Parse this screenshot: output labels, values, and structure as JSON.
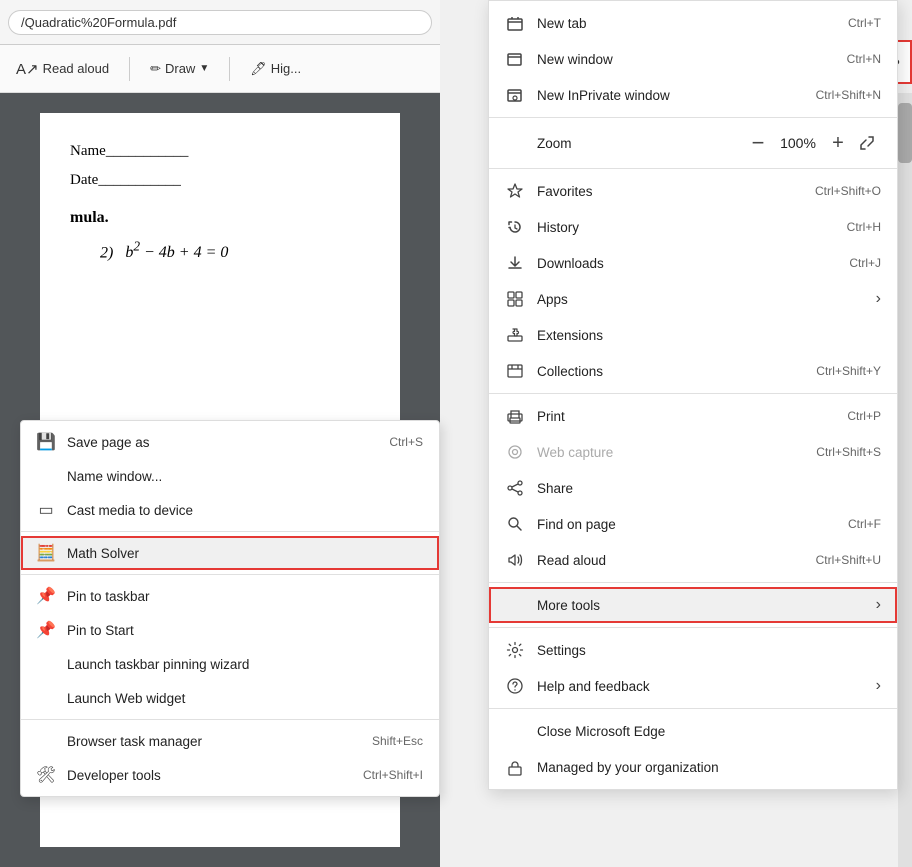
{
  "browser": {
    "url": "/Quadratic%20Formula.pdf",
    "three_dots_label": "•••"
  },
  "pdf_toolbar": {
    "read_aloud": "Read aloud",
    "draw": "Draw",
    "highlight": "Hig..."
  },
  "pdf_content": {
    "name_line": "Name___________",
    "date_line": "Date___________",
    "formula_label": "mula.",
    "equation_prefix": "2)",
    "equation": "b² − 4b + 4 = 0"
  },
  "context_menu": {
    "items": [
      {
        "id": "save-page-as",
        "icon": "💾",
        "label": "Save page as",
        "shortcut": "Ctrl+S",
        "divider_after": false
      },
      {
        "id": "name-window",
        "icon": "",
        "label": "Name window...",
        "shortcut": "",
        "divider_after": false
      },
      {
        "id": "cast-media",
        "icon": "📺",
        "label": "Cast media to device",
        "shortcut": "",
        "divider_after": false
      },
      {
        "id": "math-solver",
        "icon": "🧮",
        "label": "Math Solver",
        "shortcut": "",
        "highlighted": true,
        "divider_after": false
      },
      {
        "id": "pin-taskbar",
        "icon": "📌",
        "label": "Pin to taskbar",
        "shortcut": "",
        "divider_after": false
      },
      {
        "id": "pin-start",
        "icon": "📌",
        "label": "Pin to Start",
        "shortcut": "",
        "divider_after": false
      },
      {
        "id": "launch-wizard",
        "icon": "",
        "label": "Launch taskbar pinning wizard",
        "shortcut": "",
        "divider_after": false
      },
      {
        "id": "launch-widget",
        "icon": "",
        "label": "Launch Web widget",
        "shortcut": "",
        "divider_after": true
      },
      {
        "id": "browser-task-mgr",
        "icon": "",
        "label": "Browser task manager",
        "shortcut": "Shift+Esc",
        "divider_after": false
      },
      {
        "id": "developer-tools",
        "icon": "🛠",
        "label": "Developer tools",
        "shortcut": "Ctrl+Shift+I",
        "divider_after": false
      }
    ]
  },
  "dropdown_menu": {
    "new_tab": {
      "label": "New tab",
      "shortcut": "Ctrl+T",
      "icon": "⬜"
    },
    "new_window": {
      "label": "New window",
      "shortcut": "Ctrl+N",
      "icon": "⬜"
    },
    "new_inprivate": {
      "label": "New InPrivate window",
      "shortcut": "Ctrl+Shift+N",
      "icon": "⬜"
    },
    "zoom": {
      "label": "Zoom",
      "minus": "−",
      "value": "100%",
      "plus": "+",
      "expand": "⤢"
    },
    "favorites": {
      "label": "Favorites",
      "shortcut": "Ctrl+Shift+O",
      "icon": "⭐"
    },
    "history": {
      "label": "History",
      "shortcut": "Ctrl+H",
      "icon": "🕐"
    },
    "downloads": {
      "label": "Downloads",
      "shortcut": "Ctrl+J",
      "icon": "⬇"
    },
    "apps": {
      "label": "Apps",
      "chevron": "›",
      "icon": "🔲"
    },
    "extensions": {
      "label": "Extensions",
      "icon": "🧩"
    },
    "collections": {
      "label": "Collections",
      "shortcut": "Ctrl+Shift+Y",
      "icon": "📚"
    },
    "print": {
      "label": "Print",
      "shortcut": "Ctrl+P",
      "icon": "🖨"
    },
    "web_capture": {
      "label": "Web capture",
      "shortcut": "Ctrl+Shift+S",
      "icon": "📷",
      "disabled": true
    },
    "share": {
      "label": "Share",
      "icon": "↗"
    },
    "find_on_page": {
      "label": "Find on page",
      "shortcut": "Ctrl+F",
      "icon": "🔍"
    },
    "read_aloud": {
      "label": "Read aloud",
      "shortcut": "Ctrl+Shift+U",
      "icon": "🔊"
    },
    "more_tools": {
      "label": "More tools",
      "chevron": "›",
      "highlighted": true
    },
    "settings": {
      "label": "Settings",
      "icon": "⚙"
    },
    "help_feedback": {
      "label": "Help and feedback",
      "chevron": "›",
      "icon": "❓"
    },
    "close_edge": {
      "label": "Close Microsoft Edge",
      "icon": ""
    },
    "managed": {
      "label": "Managed by your organization",
      "icon": "🏢"
    }
  },
  "colors": {
    "highlight_border": "#e53935",
    "menu_bg": "#ffffff",
    "menu_hover": "#f0f0f0",
    "disabled_text": "#aaaaaa"
  }
}
